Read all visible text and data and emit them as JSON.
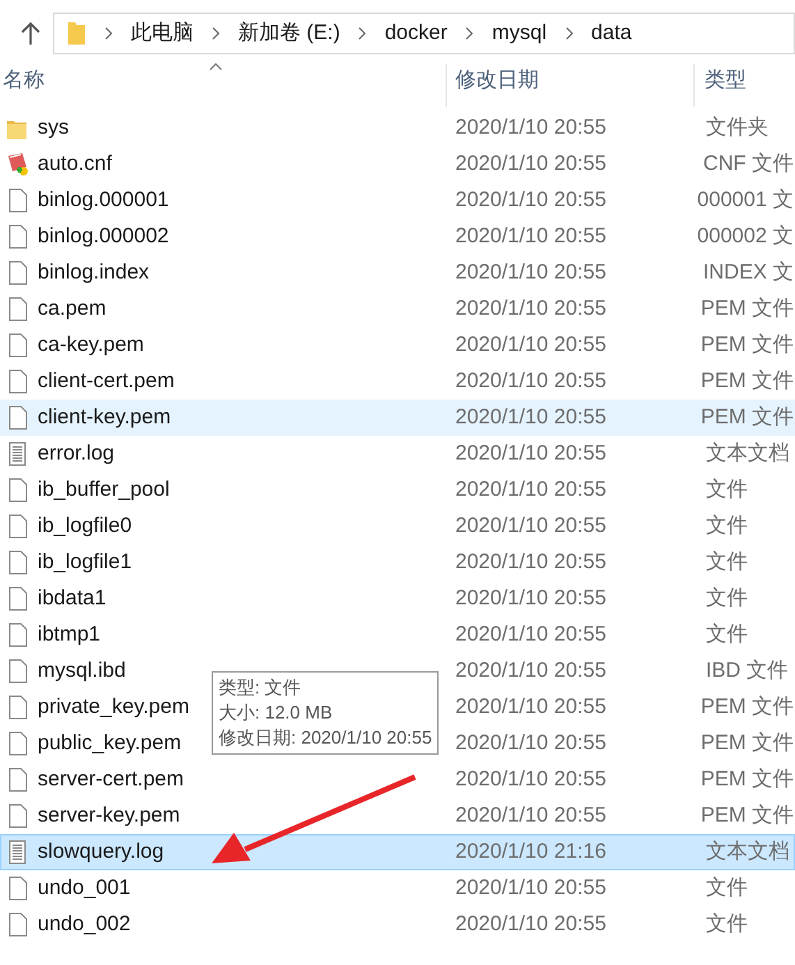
{
  "address_bar": {
    "path": [
      "此电脑",
      "新加卷 (E:)",
      "docker",
      "mysql",
      "data"
    ]
  },
  "columns": [
    "名称",
    "修改日期",
    "类型"
  ],
  "rows": [
    {
      "kind": "folder",
      "name": "sys",
      "date": "2020/1/10 20:55",
      "type": "文件夹",
      "hovered": false,
      "selected": false
    },
    {
      "kind": "cnf",
      "name": "auto.cnf",
      "date": "2020/1/10 20:55",
      "type": "CNF 文件",
      "hovered": false,
      "selected": false
    },
    {
      "kind": "file",
      "name": "binlog.000001",
      "date": "2020/1/10 20:55",
      "type": "000001 文",
      "hovered": false,
      "selected": false
    },
    {
      "kind": "file",
      "name": "binlog.000002",
      "date": "2020/1/10 20:55",
      "type": "000002 文",
      "hovered": false,
      "selected": false
    },
    {
      "kind": "file",
      "name": "binlog.index",
      "date": "2020/1/10 20:55",
      "type": "INDEX 文",
      "hovered": false,
      "selected": false
    },
    {
      "kind": "file",
      "name": "ca.pem",
      "date": "2020/1/10 20:55",
      "type": "PEM 文件",
      "hovered": false,
      "selected": false
    },
    {
      "kind": "file",
      "name": "ca-key.pem",
      "date": "2020/1/10 20:55",
      "type": "PEM 文件",
      "hovered": false,
      "selected": false
    },
    {
      "kind": "file",
      "name": "client-cert.pem",
      "date": "2020/1/10 20:55",
      "type": "PEM 文件",
      "hovered": false,
      "selected": false
    },
    {
      "kind": "file",
      "name": "client-key.pem",
      "date": "2020/1/10 20:55",
      "type": "PEM 文件",
      "hovered": true,
      "selected": false
    },
    {
      "kind": "text",
      "name": "error.log",
      "date": "2020/1/10 20:55",
      "type": "文本文档",
      "hovered": false,
      "selected": false
    },
    {
      "kind": "file",
      "name": "ib_buffer_pool",
      "date": "2020/1/10 20:55",
      "type": "文件",
      "hovered": false,
      "selected": false
    },
    {
      "kind": "file",
      "name": "ib_logfile0",
      "date": "2020/1/10 20:55",
      "type": "文件",
      "hovered": false,
      "selected": false
    },
    {
      "kind": "file",
      "name": "ib_logfile1",
      "date": "2020/1/10 20:55",
      "type": "文件",
      "hovered": false,
      "selected": false
    },
    {
      "kind": "file",
      "name": "ibdata1",
      "date": "2020/1/10 20:55",
      "type": "文件",
      "hovered": false,
      "selected": false
    },
    {
      "kind": "file",
      "name": "ibtmp1",
      "date": "2020/1/10 20:55",
      "type": "文件",
      "hovered": false,
      "selected": false
    },
    {
      "kind": "file",
      "name": "mysql.ibd",
      "date": "2020/1/10 20:55",
      "type": "IBD 文件",
      "hovered": false,
      "selected": false
    },
    {
      "kind": "file",
      "name": "private_key.pem",
      "date": "2020/1/10 20:55",
      "type": "PEM 文件",
      "hovered": false,
      "selected": false
    },
    {
      "kind": "file",
      "name": "public_key.pem",
      "date": "2020/1/10 20:55",
      "type": "PEM 文件",
      "hovered": false,
      "selected": false
    },
    {
      "kind": "file",
      "name": "server-cert.pem",
      "date": "2020/1/10 20:55",
      "type": "PEM 文件",
      "hovered": false,
      "selected": false
    },
    {
      "kind": "file",
      "name": "server-key.pem",
      "date": "2020/1/10 20:55",
      "type": "PEM 文件",
      "hovered": false,
      "selected": false
    },
    {
      "kind": "text",
      "name": "slowquery.log",
      "date": "2020/1/10 21:16",
      "type": "文本文档",
      "hovered": false,
      "selected": true
    },
    {
      "kind": "file",
      "name": "undo_001",
      "date": "2020/1/10 20:55",
      "type": "文件",
      "hovered": false,
      "selected": false
    },
    {
      "kind": "file",
      "name": "undo_002",
      "date": "2020/1/10 20:55",
      "type": "文件",
      "hovered": false,
      "selected": false
    }
  ],
  "tooltip": {
    "lines": [
      "类型: 文件",
      "大小: 12.0 MB",
      "修改日期: 2020/1/10 20:55"
    ]
  }
}
